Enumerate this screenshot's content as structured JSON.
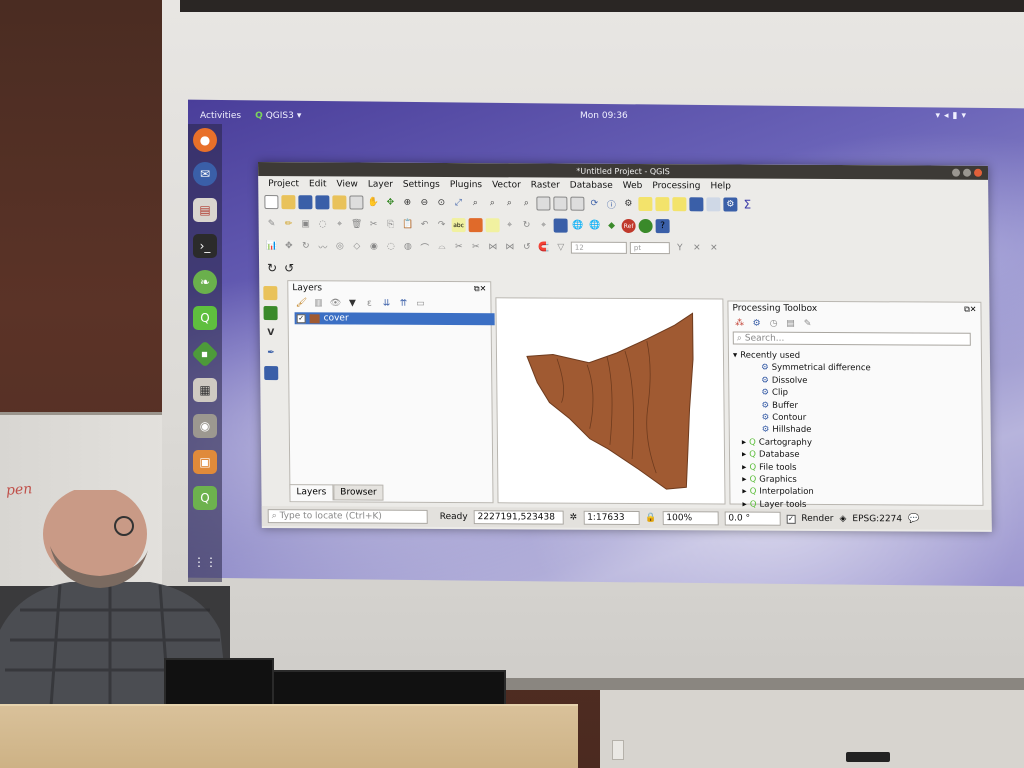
{
  "gnome": {
    "activities": "Activities",
    "app_name": "QGIS3",
    "clock": "Mon 09:36"
  },
  "window": {
    "title": "*Untitled Project - QGIS"
  },
  "menu": [
    "Project",
    "Edit",
    "View",
    "Layer",
    "Settings",
    "Plugins",
    "Vector",
    "Raster",
    "Database",
    "Web",
    "Processing",
    "Help"
  ],
  "layers_panel": {
    "title": "Layers",
    "layer_name": "cover",
    "tabs": [
      "Layers",
      "Browser"
    ]
  },
  "processing_toolbox": {
    "title": "Processing Toolbox",
    "search_placeholder": "Search...",
    "recently_used_label": "Recently used",
    "recent_items": [
      "Symmetrical difference",
      "Dissolve",
      "Clip",
      "Buffer",
      "Contour",
      "Hillshade"
    ],
    "groups": [
      "Cartography",
      "Database",
      "File tools",
      "Graphics",
      "Interpolation",
      "Layer tools"
    ]
  },
  "statusbar": {
    "locate_placeholder": "Type to locate (Ctrl+K)",
    "status": "Ready",
    "coordinate": "2227191,523438",
    "scale": "1:17633",
    "magnifier": "100%",
    "rotation": "0.0 °",
    "render_label": "Render",
    "crs": "EPSG:2274"
  },
  "toolbar3": {
    "font_size": "12",
    "unit": "pt"
  },
  "whiteboard_text": "pen",
  "colors": {
    "polygon_fill": "#a05a32",
    "selection": "#3b6fc4",
    "qgis_green": "#7bd65b"
  }
}
